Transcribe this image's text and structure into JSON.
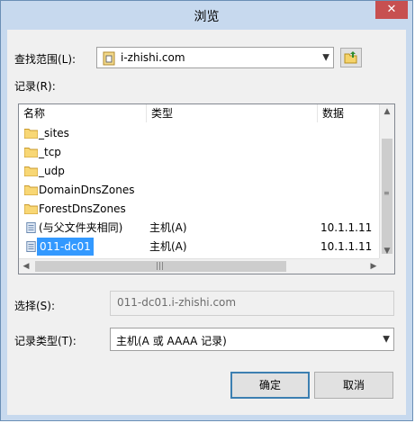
{
  "window": {
    "title": "浏览",
    "close_glyph": "✕"
  },
  "lookin": {
    "label": "查找范围(L):",
    "value": "i-zhishi.com",
    "icon": "domain-icon",
    "button_icon": "up-folder-icon"
  },
  "records": {
    "label": "记录(R):",
    "columns": [
      "名称",
      "类型",
      "数据"
    ],
    "rows": [
      {
        "name": "_sites",
        "type": "",
        "data": "",
        "icon": "folder-icon"
      },
      {
        "name": "_tcp",
        "type": "",
        "data": "",
        "icon": "folder-icon"
      },
      {
        "name": "_udp",
        "type": "",
        "data": "",
        "icon": "folder-icon"
      },
      {
        "name": "DomainDnsZones",
        "type": "",
        "data": "",
        "icon": "folder-icon"
      },
      {
        "name": "ForestDnsZones",
        "type": "",
        "data": "",
        "icon": "folder-icon"
      },
      {
        "name": "(与父文件夹相同)",
        "type": "主机(A)",
        "data": "10.1.1.11",
        "icon": "record-icon"
      },
      {
        "name": "011-dc01",
        "type": "主机(A)",
        "data": "10.1.1.11",
        "icon": "record-icon",
        "selected": true
      }
    ]
  },
  "selection": {
    "label": "选择(S):",
    "value": "011-dc01.i-zhishi.com"
  },
  "record_type": {
    "label": "记录类型(T):",
    "value": "主机(A 或 AAAA 记录)"
  },
  "buttons": {
    "ok": "确定",
    "cancel": "取消"
  },
  "colors": {
    "title_bar": "#c7d9ee",
    "close_button": "#c75050",
    "selection": "#3399ff",
    "default_button_border": "#3c7fb1"
  }
}
